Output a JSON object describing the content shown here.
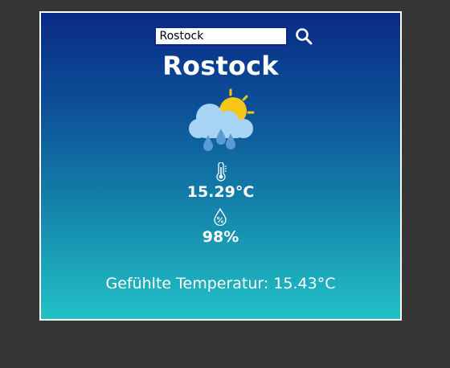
{
  "search": {
    "value": "Rostock"
  },
  "weather": {
    "city": "Rostock",
    "condition_icon": "cloud-sun-rain-icon",
    "temperature": "15.29°C",
    "humidity": "98%",
    "feels_like": "Gefühlte Temperatur: 15.43°C"
  },
  "colors": {
    "background": "#363636",
    "card_gradient_top": "#0a2a85",
    "card_gradient_bottom": "#22c1c6",
    "sun": "#f5c518",
    "cloud": "#a8d4f5",
    "rain": "#5b9bd5"
  }
}
